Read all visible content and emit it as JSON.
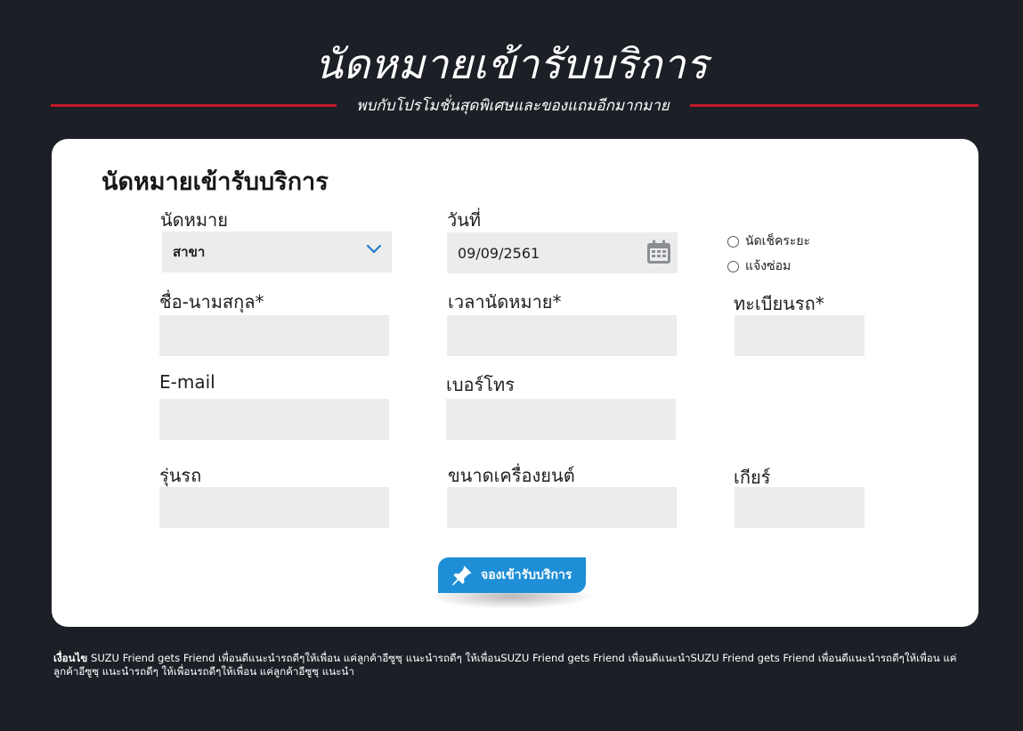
{
  "page": {
    "title": "นัดหมายเข้ารับบริการ",
    "subtitle": "พบกับโปรโมชั่นสุดพิเศษและของแถมอีกมากมาย"
  },
  "form": {
    "heading": "นัดหมายเข้ารับบริการ",
    "appointment": {
      "label": "นัดหมาย",
      "branch_value": "สาขา"
    },
    "date": {
      "label": "วันที่",
      "value": "09/09/2561"
    },
    "service_type": {
      "options": [
        "นัดเช็คระยะ",
        "แจ้งซ่อม"
      ]
    },
    "fields": {
      "full_name": "ชื่อ-นามสกุล*",
      "appointment_time": "เวลานัดหมาย*",
      "license_plate": "ทะเบียนรถ*",
      "email": "E-mail",
      "phone": "เบอร์โทร",
      "car_model": "รุ่นรถ",
      "engine_size": "ขนาดเครื่องยนต์",
      "gear": "เกียร์"
    },
    "submit_label": "จองเข้ารับบริการ"
  },
  "footnote": {
    "label": "เงื่อนไข",
    "text": " SUZU Friend gets Friend เพื่อนดีแนะนำรถดีๆให้เพื่อน แค่ลูกค้าอีซูซุ แนะนำรถดีๆ ให้เพื่อนSUZU Friend gets Friend เพื่อนดีแนะนำSUZU Friend gets Friend เพื่อนดีแนะนำรถดีๆให้เพื่อน แค่ลูกค้าอีซูซุ แนะนำรถดีๆ ให้เพื่อนรถดีๆให้เพื่อน แค่ลูกค้าอีซูซุ แนะนำ"
  },
  "colors": {
    "background": "#1c1f26",
    "accent_red": "#c4182b",
    "button_blue": "#1e8fd6",
    "input_gray": "#ececed"
  },
  "icons": {
    "dropdown": "chevron-down-icon",
    "calendar": "calendar-icon",
    "submit": "pushpin-icon"
  }
}
